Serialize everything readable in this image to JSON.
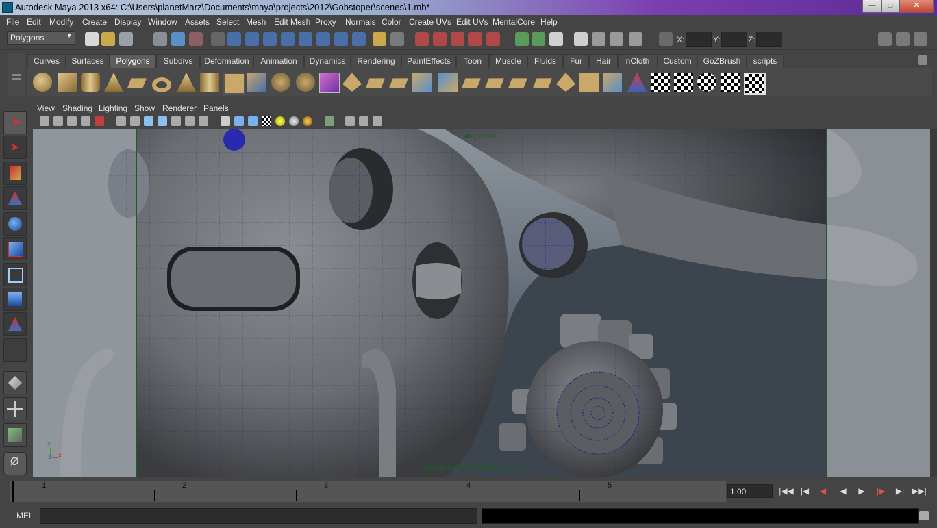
{
  "window": {
    "title": "Autodesk Maya 2013 x64: C:\\Users\\planetMarz\\Documents\\maya\\projects\\2012\\Gobstoper\\scenes\\1.mb*",
    "minimize": "—",
    "maximize": "□",
    "close": "✕"
  },
  "menubar": [
    "File",
    "Edit",
    "Modify",
    "Create",
    "Display",
    "Window",
    "Assets",
    "Select",
    "Mesh",
    "Edit Mesh",
    "Proxy",
    "Normals",
    "Color",
    "Create UVs",
    "Edit UVs",
    "MentalCore",
    "Help"
  ],
  "statusline": {
    "mode": "Polygons",
    "x_label": "X:",
    "y_label": "Y:",
    "z_label": "Z:",
    "x_value": "",
    "y_value": "",
    "z_value": ""
  },
  "shelf": {
    "tabs": [
      "Curves",
      "Surfaces",
      "Polygons",
      "Subdivs",
      "Deformation",
      "Animation",
      "Dynamics",
      "Rendering",
      "PaintEffects",
      "Toon",
      "Muscle",
      "Fluids",
      "Fur",
      "Hair",
      "nCloth",
      "Custom",
      "GoZBrush",
      "scripts"
    ],
    "active_tab": "Polygons"
  },
  "panel": {
    "menus": [
      "View",
      "Shading",
      "Lighting",
      "Show",
      "Renderer",
      "Panels"
    ],
    "resolution_gate": "480 x 300",
    "camera_label": "persp    defaultRenderLayer",
    "axis_y": "y",
    "axis_x": "x",
    "axis_z": "z"
  },
  "timeline": {
    "ticks": [
      "1",
      "2",
      "3",
      "4",
      "5"
    ],
    "current_time": "1.00"
  },
  "playback": {
    "goto_start": "|◀◀",
    "step_back_key": "|◀",
    "step_back_frame": "◀|",
    "play_back": "◀",
    "play_forward": "▶",
    "step_forward_frame": "|▶",
    "step_forward_key": "▶|",
    "goto_end": "▶▶|"
  },
  "command_line": {
    "label": "MEL",
    "value": ""
  },
  "colors": {
    "ui_bg": "#444444",
    "field_bg": "#2b2b2b",
    "wire": "#1a1a8c",
    "gate_line": "#1f5a2a",
    "accent_purple": "#6a35a8"
  }
}
